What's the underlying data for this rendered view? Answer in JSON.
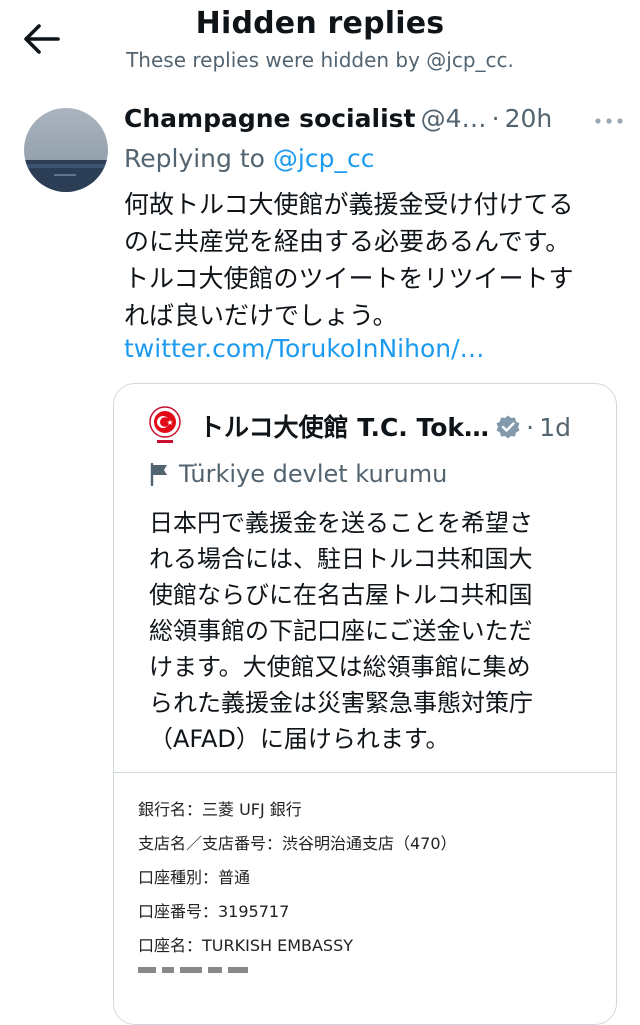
{
  "header": {
    "title": "Hidden replies",
    "subtitle": "These replies were hidden by @jcp_cc."
  },
  "tweet": {
    "display_name": "Champagne socialist",
    "handle": "@4…",
    "separator": "·",
    "time": "20h",
    "replying_prefix": "Replying to ",
    "replying_to": "@jcp_cc",
    "text_lines": [
      "何故トルコ大使館が義援金受け付けてる",
      "のに共産党を経由する必要あるんです。",
      "トルコ大使館のツイートをリツイートす",
      "れば良いだけでしょう。"
    ],
    "link": "twitter.com/TorukoInNihon/…"
  },
  "quote": {
    "name": "トルコ大使館 T.C. Tok…",
    "separator": "·",
    "time": "1d",
    "label": "Türkiye devlet kurumu",
    "text_lines": [
      "日本円で義援金を送ることを希望さ",
      "れる場合には、駐日トルコ共和国大",
      "使館ならびに在名古屋トルコ共和国",
      "総領事館の下記口座にご送金いただ",
      "けます。大使館又は総領事館に集め",
      "られた義援金は災害緊急事態対策庁",
      "（AFAD）に届けられます。"
    ],
    "image_lines": [
      "銀行名：三菱 UFJ 銀行",
      "支店名／支店番号：渋谷明治通支店（470）",
      "口座種別：普通",
      "口座番号：3195717",
      "口座名：TURKISH EMBASSY"
    ]
  },
  "icons": {
    "back": "arrow-left-icon",
    "more": "more-dots-icon",
    "verified": "verified-badge-icon",
    "flag": "flag-icon",
    "emblem": "embassy-emblem-icon"
  },
  "colors": {
    "link": "#1d9bf0",
    "secondary_text": "#536471",
    "border": "#cfd9de",
    "verified_badge": "#829aab"
  }
}
